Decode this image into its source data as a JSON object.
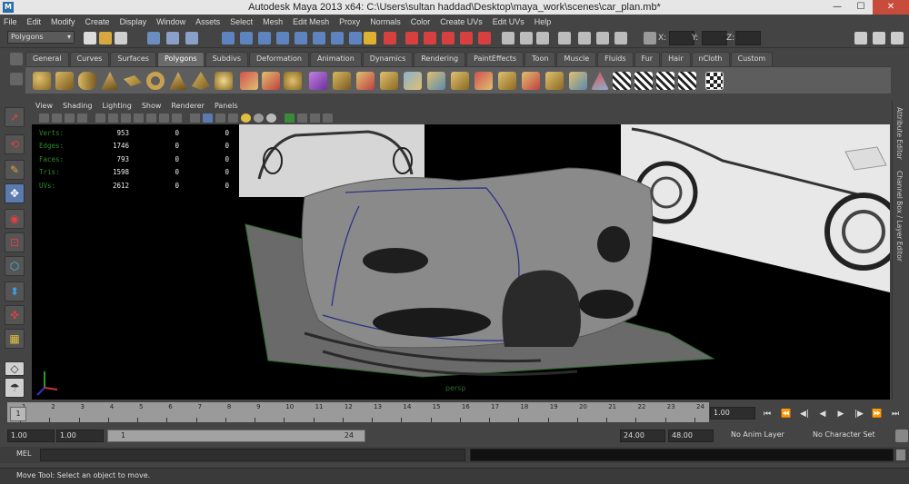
{
  "window": {
    "app_icon": "M",
    "title": "Autodesk Maya 2013 x64: C:\\Users\\sultan haddad\\Desktop\\maya_work\\scenes\\car_plan.mb*",
    "minimize": "—",
    "maximize": "☐",
    "close": "✕"
  },
  "menubar": [
    "File",
    "Edit",
    "Modify",
    "Create",
    "Display",
    "Window",
    "Assets",
    "Select",
    "Mesh",
    "Edit Mesh",
    "Proxy",
    "Normals",
    "Color",
    "Create UVs",
    "Edit UVs",
    "Help"
  ],
  "status_line": {
    "mode": "Polygons",
    "x_label": "X:",
    "y_label": "Y:",
    "z_label": "Z:"
  },
  "shelf_tabs": [
    "General",
    "Curves",
    "Surfaces",
    "Polygons",
    "Subdivs",
    "Deformation",
    "Animation",
    "Dynamics",
    "Rendering",
    "PaintEffects",
    "Toon",
    "Muscle",
    "Fluids",
    "Fur",
    "Hair",
    "nCloth",
    "Custom"
  ],
  "active_shelf": "Polygons",
  "panel_menu": [
    "View",
    "Shading",
    "Lighting",
    "Show",
    "Renderer",
    "Panels"
  ],
  "hud": {
    "rows": [
      {
        "label": "Verts:",
        "v1": "953",
        "v2": "0",
        "v3": "0"
      },
      {
        "label": "Edges:",
        "v1": "1746",
        "v2": "0",
        "v3": "0"
      },
      {
        "label": "Faces:",
        "v1": "793",
        "v2": "0",
        "v3": "0"
      },
      {
        "label": "Tris:",
        "v1": "1598",
        "v2": "0",
        "v3": "0"
      },
      {
        "label": "UVs:",
        "v1": "2612",
        "v2": "0",
        "v3": "0"
      }
    ],
    "camera": "persp"
  },
  "right_tabs": {
    "attribute_editor": "Attribute Editor",
    "channel_box": "Channel Box / Layer Editor"
  },
  "timeline": {
    "ticks": [
      "1",
      "2",
      "3",
      "4",
      "5",
      "6",
      "7",
      "8",
      "9",
      "10",
      "11",
      "12",
      "13",
      "14",
      "15",
      "16",
      "17",
      "18",
      "19",
      "20",
      "21",
      "22",
      "23",
      "24"
    ],
    "current_frame": "1",
    "current_time_field": "1.00"
  },
  "playback": {
    "buttons": [
      "⏮",
      "⏪",
      "◀|",
      "◀",
      "▶",
      "|▶",
      "⏩",
      "⏭"
    ]
  },
  "range": {
    "start_time": "1.00",
    "playback_start": "1.00",
    "range_start": "1",
    "range_end": "24",
    "playback_end": "24.00",
    "end_time": "48.00",
    "anim_layer": "No Anim Layer",
    "character_set": "No Character Set"
  },
  "command_line": {
    "label": "MEL"
  },
  "help_line": "Move Tool: Select an object to move.",
  "colors": {
    "hud_label": "#2e8a2e",
    "viewport_bg": "#000000",
    "car_body": "#8a8a8a",
    "wire": "#2a2a88",
    "grid_green": "#2c6b2c"
  }
}
